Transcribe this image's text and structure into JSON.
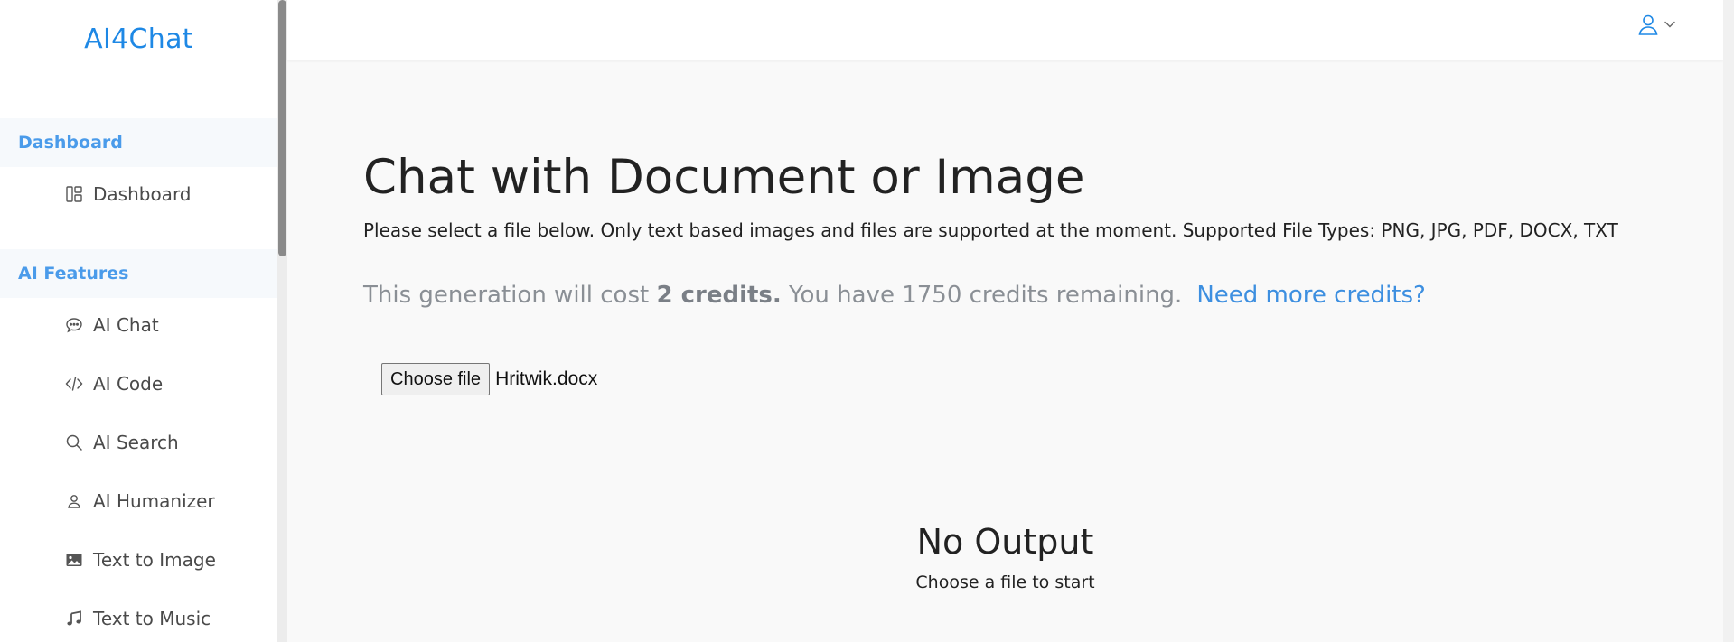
{
  "brand": {
    "name": "AI4Chat"
  },
  "sidebar": {
    "sections": [
      {
        "header": "Dashboard",
        "items": [
          {
            "label": "Dashboard",
            "icon": "layout-icon"
          }
        ]
      },
      {
        "header": "AI Features",
        "items": [
          {
            "label": "AI Chat",
            "icon": "chat-bubble-icon"
          },
          {
            "label": "AI Code",
            "icon": "code-icon"
          },
          {
            "label": "AI Search",
            "icon": "search-icon"
          },
          {
            "label": "AI Humanizer",
            "icon": "user-icon"
          },
          {
            "label": "Text to Image",
            "icon": "image-icon"
          },
          {
            "label": "Text to Music",
            "icon": "music-note-icon"
          }
        ]
      }
    ]
  },
  "topbar": {
    "user_icon": "user-icon",
    "chevron_icon": "chevron-down-icon"
  },
  "main": {
    "title": "Chat with Document or Image",
    "description": "Please select a file below. Only text based images and files are supported at the moment. Supported File Types: PNG, JPG, PDF, DOCX, TXT",
    "cost": {
      "prefix": "This generation will cost ",
      "credits_cost": "2 credits.",
      "remaining": " You have 1750 credits remaining.",
      "more_link": "Need more credits?"
    },
    "file_input": {
      "button_label": "Choose file",
      "file_name": "Hritwik.docx"
    },
    "output": {
      "title": "No Output",
      "subtitle": "Choose a file to start"
    }
  },
  "colors": {
    "accent": "#1e88e5",
    "link": "#3d8fe0",
    "section_header": "#4a9bea"
  }
}
